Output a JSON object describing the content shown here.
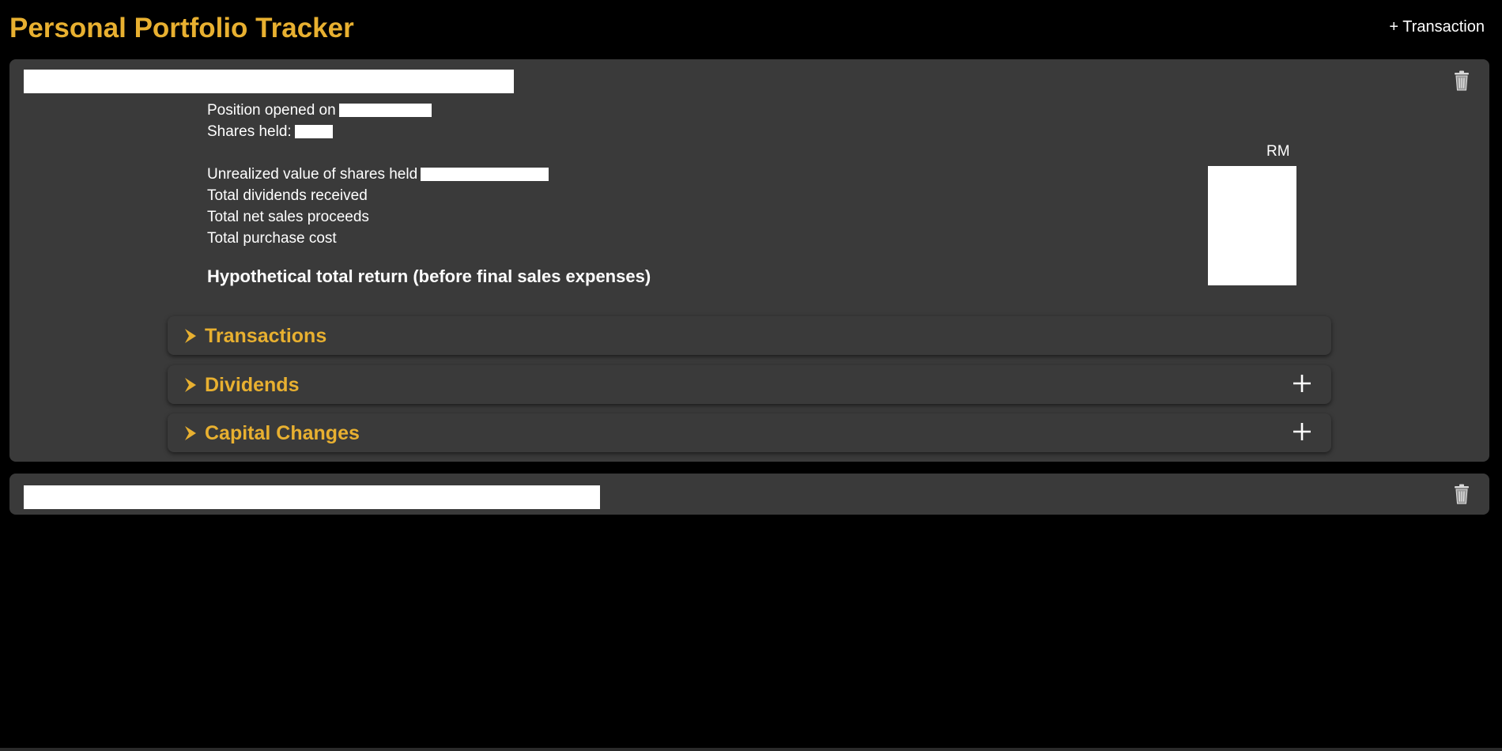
{
  "header": {
    "title": "Personal Portfolio Tracker",
    "add_transaction_label": "+ Transaction"
  },
  "positions": [
    {
      "name_value": "",
      "expanded": true,
      "labels": {
        "opened_on": "Position opened on",
        "shares_held": "Shares held:",
        "unrealized_value": "Unrealized value of shares held",
        "total_dividends": "Total dividends received",
        "total_net_sales": "Total net sales proceeds",
        "total_purchase_cost": "Total purchase cost",
        "hypothetical_return": "Hypothetical total return (before final sales expenses)"
      },
      "currency": "RM",
      "sections": [
        {
          "title": "Transactions",
          "has_add": false
        },
        {
          "title": "Dividends",
          "has_add": true
        },
        {
          "title": "Capital Changes",
          "has_add": true
        }
      ]
    },
    {
      "name_value": "",
      "expanded": false
    }
  ],
  "icons": {
    "delete": "trash-icon",
    "expand": "chevron-right-icon",
    "add": "plus-icon"
  },
  "colors": {
    "background": "#000000",
    "card": "#3a3a3a",
    "accent": "#e8b030",
    "text": "#ffffff"
  }
}
